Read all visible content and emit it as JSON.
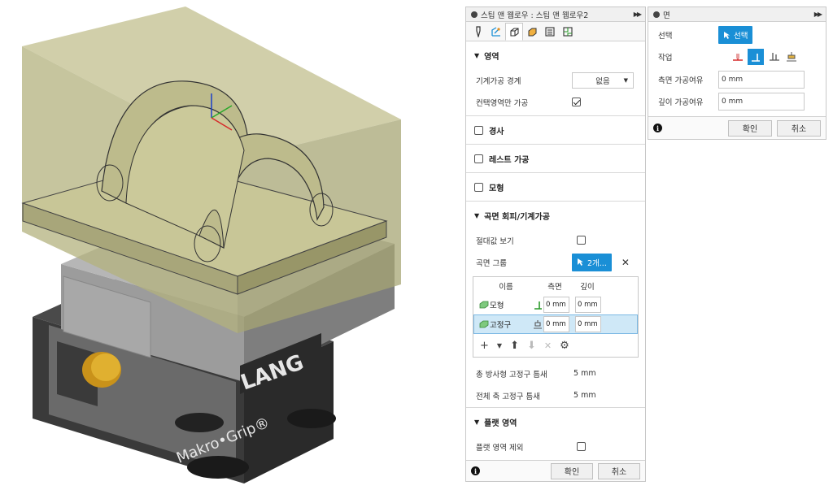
{
  "left_panel": {
    "title": "스팁 앤 웹로우 : 스팁 앤 웹로우2",
    "sections": {
      "area": {
        "title": "영역",
        "machining_boundary_label": "기계가공 경계",
        "machining_boundary_value": "없음",
        "contact_only_label": "컨택영역만 가공"
      },
      "tilt": {
        "title": "경사"
      },
      "rest": {
        "title": "레스트 가공"
      },
      "model": {
        "title": "모형"
      },
      "avoid": {
        "title": "곡면 회피/기계가공",
        "show_max_label": "절대값 보기",
        "surface_group_label": "곡면 그룹",
        "surface_group_value": "2개...",
        "table_headers": {
          "name": "이름",
          "side": "측면",
          "depth": "깊이"
        },
        "rows": [
          {
            "name": "모형",
            "side": "0 mm",
            "depth": "0 mm"
          },
          {
            "name": "고정구",
            "side": "0 mm",
            "depth": "0 mm"
          }
        ],
        "total_radial_label": "총 방사형 고정구 틈새",
        "total_radial_value": "5 mm",
        "total_axial_label": "전체 축 고정구 틈새",
        "total_axial_value": "5 mm"
      },
      "flat": {
        "title": "플랫 영역",
        "exclude_label": "플랫 영역 제외"
      }
    },
    "ok_label": "확인",
    "cancel_label": "취소"
  },
  "right_panel": {
    "title": "면",
    "select_label": "선택",
    "select_button": "선택",
    "operation_label": "작업",
    "side_allowance_label": "측면 가공여유",
    "side_allowance_value": "0 mm",
    "depth_allowance_label": "깊이 가공여유",
    "depth_allowance_value": "0 mm",
    "ok_label": "확인",
    "cancel_label": "취소"
  },
  "viewport": {
    "brand_text": "LANG",
    "product_text": "Makro•Grip®"
  },
  "colors": {
    "accent": "#1a8fd6",
    "row_selected": "#cfe8f7"
  }
}
